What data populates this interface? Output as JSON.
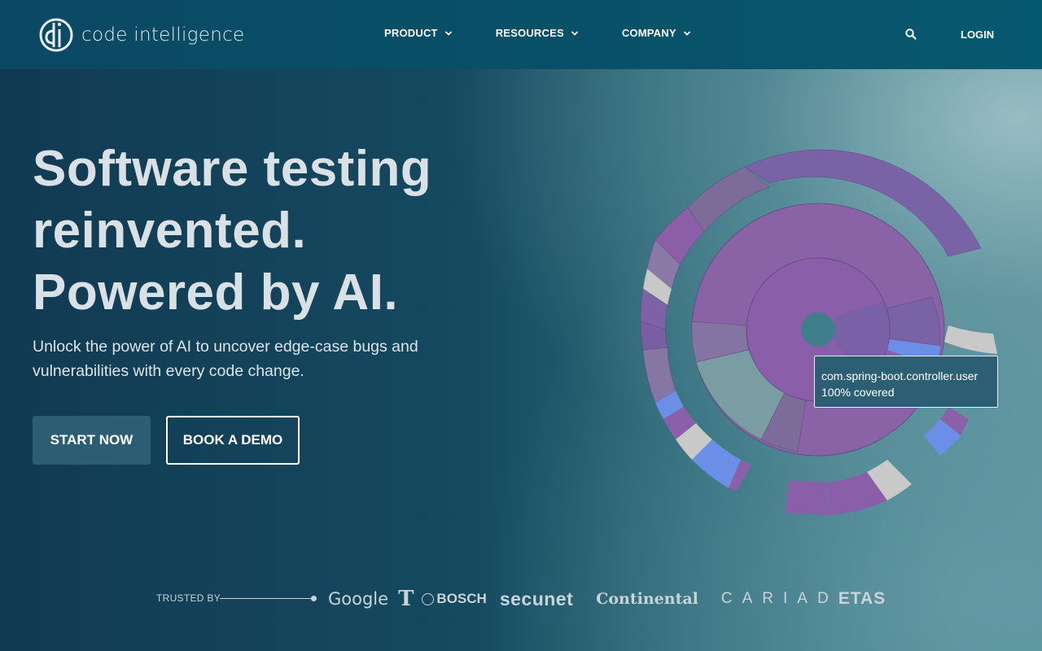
{
  "header": {
    "logo_text": "code intelligence",
    "nav": [
      {
        "label": "PRODUCT"
      },
      {
        "label": "RESOURCES"
      },
      {
        "label": "COMPANY"
      }
    ],
    "login_label": "LOGIN"
  },
  "hero": {
    "headline": [
      "Software testing",
      "reinvented.",
      "Powered by AI."
    ],
    "subtitle": "Unlock the power of AI to uncover edge-case bugs and vulnerabilities with every code change.",
    "primary_cta": "START NOW",
    "secondary_cta": "BOOK A DEMO"
  },
  "tooltip": {
    "line1": "com.spring-boot.controller.user",
    "line2": "100% covered"
  },
  "trusted": {
    "label": "TRUSTED BY",
    "logos": {
      "google": "Google",
      "telekom": "T",
      "bosch": "BOSCH",
      "secunet": "secunet",
      "continental": "Continental",
      "cariad": "CARIAD",
      "etas": "ETAS"
    }
  },
  "icons": {
    "search": "search-icon",
    "chevron": "chevron-down-icon",
    "logo": "code-intelligence-logo-icon"
  },
  "colors": {
    "accent_purple": "#8a60a8",
    "accent_blue": "#6b8fe6",
    "primary_button": "#2c5d73"
  }
}
